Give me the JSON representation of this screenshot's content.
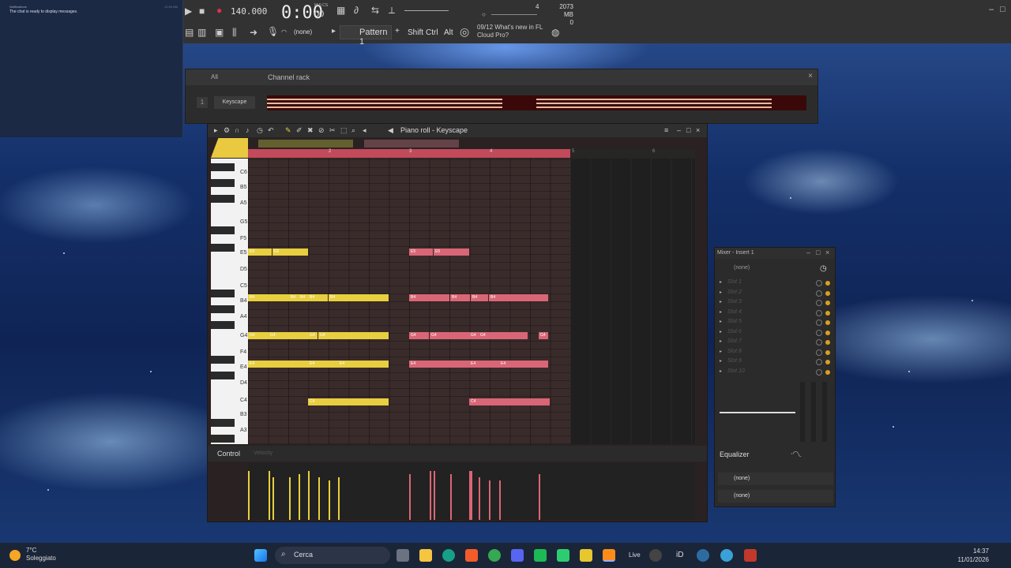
{
  "notification": {
    "title": "Notifications",
    "message": "The chat is ready to display messages.",
    "time": "12:00 AM"
  },
  "toolbar": {
    "tempo": "140.000",
    "time": "0:00",
    "time_sub": "00",
    "time_unit": "M:S:CS",
    "memory": "2073 MB",
    "voices": "0",
    "beat_counter": "4",
    "input_none": "(none)",
    "pattern": "Pattern 1",
    "plus": "+",
    "shift": "Shift",
    "ctrl": "Ctrl",
    "alt": "Alt",
    "news_count": "09/12",
    "news_line1": "What's new in FL",
    "news_line2": "Cloud Pro?"
  },
  "channel_rack": {
    "filter": "All",
    "title": "Channel rack",
    "number": "1",
    "instrument": "Keyscape"
  },
  "piano_roll": {
    "title": "Piano roll - Keyscape",
    "bar_numbers": [
      "2",
      "3",
      "4",
      "5",
      "6"
    ],
    "key_labels": [
      "C6",
      "B5",
      "A5",
      "G5",
      "F5",
      "E5",
      "D5",
      "C5",
      "B4",
      "A4",
      "G4",
      "F4",
      "E4",
      "D4",
      "C4",
      "B3",
      "A3"
    ],
    "control_label": "Control",
    "velocity_label": "Velocity",
    "notes": [
      {
        "pitch": "E5",
        "label": "E5",
        "color": "y"
      },
      {
        "pitch": "E5",
        "label": "E5",
        "color": "y"
      },
      {
        "pitch": "E5",
        "label": "E5",
        "color": "p"
      },
      {
        "pitch": "E5",
        "label": "E5",
        "color": "p"
      },
      {
        "pitch": "B4",
        "label": "B4",
        "color": "y"
      },
      {
        "pitch": "B4",
        "label": "B4",
        "color": "y"
      },
      {
        "pitch": "B4",
        "label": "B4",
        "color": "y"
      },
      {
        "pitch": "B4",
        "label": "B4",
        "color": "y"
      },
      {
        "pitch": "B4",
        "label": "B4",
        "color": "y"
      },
      {
        "pitch": "B4",
        "label": "B4",
        "color": "p"
      },
      {
        "pitch": "B4",
        "label": "B4",
        "color": "p"
      },
      {
        "pitch": "B4",
        "label": "B4",
        "color": "p"
      },
      {
        "pitch": "B4",
        "label": "B4",
        "color": "p"
      },
      {
        "pitch": "B4",
        "label": "B4",
        "color": "p"
      },
      {
        "pitch": "G4",
        "label": "G4",
        "color": "y"
      },
      {
        "pitch": "G4",
        "label": "G4",
        "color": "y"
      },
      {
        "pitch": "G4",
        "label": "G4",
        "color": "y"
      },
      {
        "pitch": "G4",
        "label": "G4",
        "color": "y"
      },
      {
        "pitch": "G4",
        "label": "G4",
        "color": "p"
      },
      {
        "pitch": "G4",
        "label": "G4",
        "color": "p"
      },
      {
        "pitch": "G4",
        "label": "G4",
        "color": "p"
      },
      {
        "pitch": "G4",
        "label": "G4",
        "color": "p"
      },
      {
        "pitch": "G4",
        "label": "G4",
        "color": "p"
      },
      {
        "pitch": "E4",
        "label": "E4",
        "color": "y"
      },
      {
        "pitch": "E4",
        "label": "E4",
        "color": "y"
      },
      {
        "pitch": "E4",
        "label": "E4",
        "color": "y"
      },
      {
        "pitch": "E4",
        "label": "E4",
        "color": "p"
      },
      {
        "pitch": "E4",
        "label": "E4",
        "color": "p"
      },
      {
        "pitch": "E4",
        "label": "E4",
        "color": "p"
      },
      {
        "pitch": "C4",
        "label": "C4",
        "color": "y"
      },
      {
        "pitch": "C4",
        "label": "C4",
        "color": "p"
      }
    ]
  },
  "mixer": {
    "title": "Mixer - Insert 1",
    "input": "(none)",
    "slots": [
      "Slot 1",
      "Slot 2",
      "Slot 3",
      "Slot 4",
      "Slot 5",
      "Slot 6",
      "Slot 7",
      "Slot 8",
      "Slot 9",
      "Slot 10"
    ],
    "equalizer": "Equalizer",
    "out1": "(none)",
    "out2": "(none)"
  },
  "taskbar": {
    "temp": "7°C",
    "weather": "Soleggiato",
    "search": "Cerca",
    "time": "14:37",
    "date": "11/01/2026",
    "live": "Live",
    "id": "iD"
  },
  "colors": {
    "yellow_note": "#e8cf3f",
    "pink_note": "#d96676",
    "timeline": "#c24a5a"
  }
}
